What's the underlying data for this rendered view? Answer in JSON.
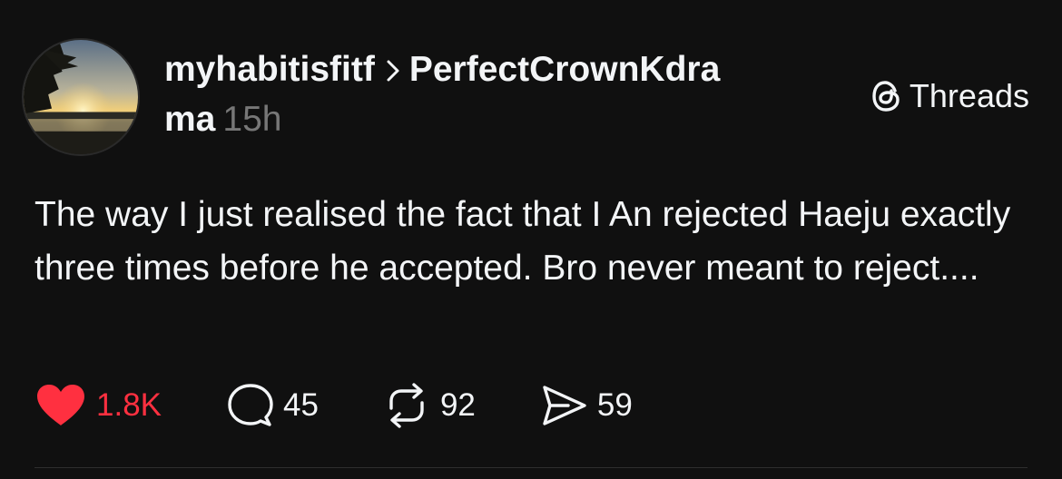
{
  "post": {
    "author": "myhabitisfitf",
    "reply_to_line1": "PerfectCrownKdra",
    "reply_to_line2": "ma",
    "time": "15h",
    "text": "The way I just realised the fact that I An rejected Haeju exactly three times before he accepted. Bro never meant to reject....",
    "source_label": "Threads"
  },
  "actions": {
    "likes": "1.8K",
    "replies": "45",
    "reposts": "92",
    "shares": "59"
  },
  "colors": {
    "background": "#101010",
    "like": "#ff3040",
    "text": "#f3f5f7",
    "muted": "#777777"
  },
  "icons": [
    "avatar-photo",
    "chevron-right-icon",
    "threads-logo-icon",
    "heart-icon",
    "comment-icon",
    "repost-icon",
    "share-icon"
  ]
}
